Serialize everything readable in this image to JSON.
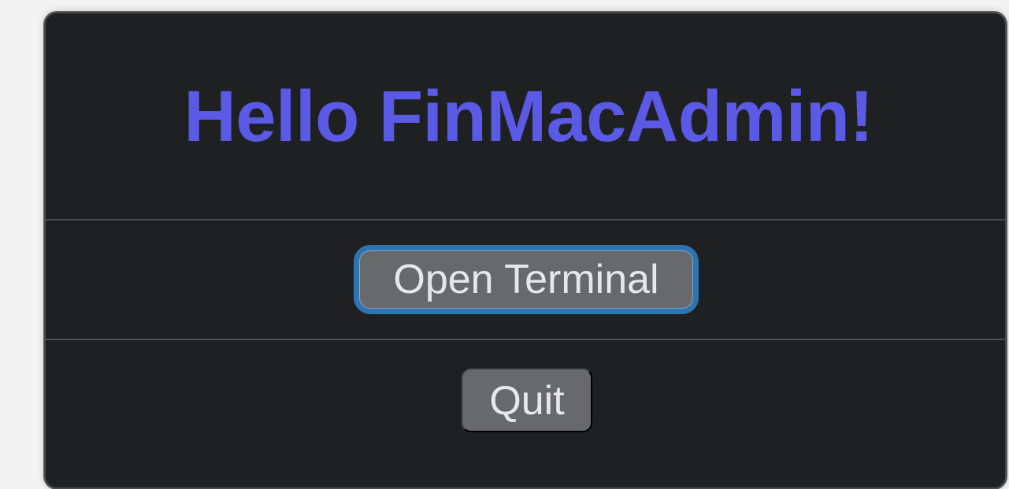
{
  "window": {
    "title_text": "Hello FinMacAdmin!",
    "title_color": "#5b5ae6"
  },
  "buttons": {
    "open_terminal_label": "Open Terminal",
    "quit_label": "Quit"
  },
  "colors": {
    "background": "#1f2021",
    "focus_ring": "#2f74b1",
    "button_fill": "#68696b"
  }
}
